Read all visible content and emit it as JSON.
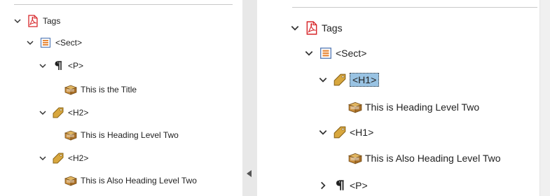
{
  "left_panel": {
    "tree": [
      {
        "label": "Tags",
        "icon": "pdf-icon",
        "expanded": true
      },
      {
        "label": "<Sect>",
        "icon": "section-icon",
        "expanded": true
      },
      {
        "label": "<P>",
        "icon": "paragraph-icon",
        "expanded": true
      },
      {
        "label": "This is the Title",
        "icon": "content-box-icon"
      },
      {
        "label": "<H2>",
        "icon": "tag-icon",
        "expanded": true
      },
      {
        "label": "This is Heading Level Two",
        "icon": "content-box-icon"
      },
      {
        "label": "<H2>",
        "icon": "tag-icon",
        "expanded": true
      },
      {
        "label": "This is Also Heading Level Two",
        "icon": "content-box-icon"
      }
    ]
  },
  "right_panel": {
    "tree": [
      {
        "label": "Tags",
        "icon": "pdf-icon",
        "expanded": true
      },
      {
        "label": "<Sect>",
        "icon": "section-icon",
        "expanded": true
      },
      {
        "label": "<H1>",
        "icon": "tag-icon",
        "expanded": true,
        "selected": true
      },
      {
        "label": "This is Heading Level Two",
        "icon": "content-box-icon"
      },
      {
        "label": "<H1>",
        "icon": "tag-icon",
        "expanded": true
      },
      {
        "label": "This is Also Heading Level Two",
        "icon": "content-box-icon"
      },
      {
        "label": "<P>",
        "icon": "paragraph-icon",
        "expanded": false
      }
    ]
  },
  "splitter": {
    "collapse_icon": "triangle-left-icon"
  },
  "colors": {
    "selection": "#99c3e3",
    "pdf_red": "#d7262a",
    "tag_gold": "#d8a73e",
    "box_brown": "#b07a2a"
  }
}
